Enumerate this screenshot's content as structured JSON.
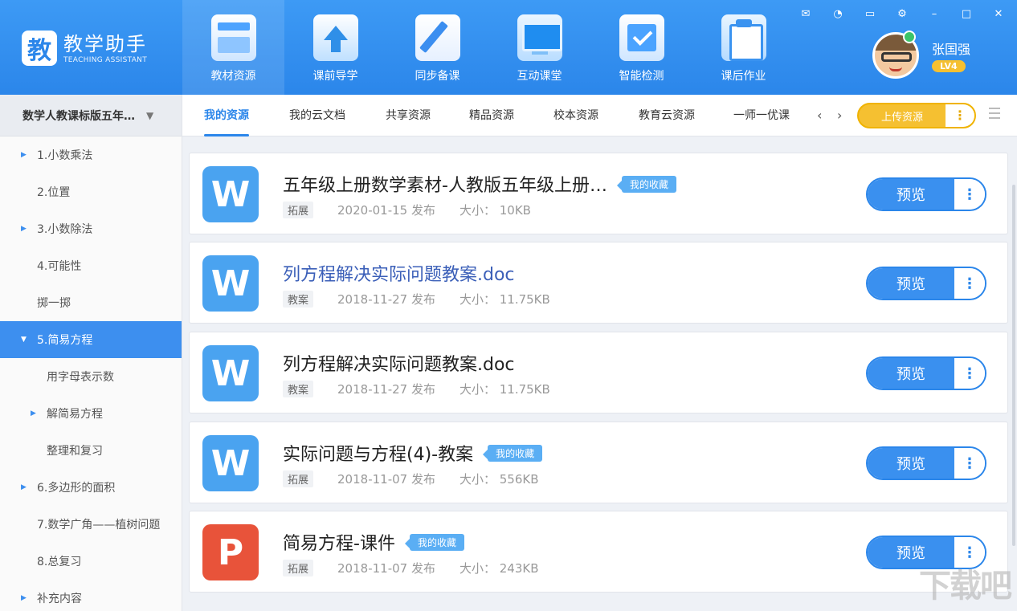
{
  "app": {
    "logo_char": "教",
    "name": "教学助手",
    "name_en": "TEACHING ASSISTANT"
  },
  "modules": [
    {
      "label": "教材资源"
    },
    {
      "label": "课前导学"
    },
    {
      "label": "同步备课"
    },
    {
      "label": "互动课堂"
    },
    {
      "label": "智能检测"
    },
    {
      "label": "课后作业"
    }
  ],
  "window_controls": {
    "message": "✉",
    "support": "◔",
    "chat": "▭",
    "settings": "⚙",
    "minimize": "–",
    "maximize": "□",
    "close": "✕"
  },
  "user": {
    "name": "张国强",
    "level": "LV4"
  },
  "sidebar": {
    "textbook": "数学人教课标版五年…",
    "textbook_arrow": "▼",
    "items": [
      {
        "label": "1.小数乘法",
        "arrow": "▶"
      },
      {
        "label": "2.位置",
        "arrow": ""
      },
      {
        "label": "3.小数除法",
        "arrow": "▶"
      },
      {
        "label": "4.可能性",
        "arrow": ""
      },
      {
        "label": "掷一掷",
        "arrow": ""
      },
      {
        "label": "5.简易方程",
        "arrow": "▼"
      },
      {
        "label": "用字母表示数",
        "arrow": ""
      },
      {
        "label": "解简易方程",
        "arrow": "▶"
      },
      {
        "label": "整理和复习",
        "arrow": ""
      },
      {
        "label": "6.多边形的面积",
        "arrow": "▶"
      },
      {
        "label": "7.数学广角——植树问题",
        "arrow": ""
      },
      {
        "label": "8.总复习",
        "arrow": ""
      },
      {
        "label": "补充内容",
        "arrow": "▶"
      }
    ]
  },
  "tabs": [
    {
      "label": "我的资源"
    },
    {
      "label": "我的云文档"
    },
    {
      "label": "共享资源"
    },
    {
      "label": "精品资源"
    },
    {
      "label": "校本资源"
    },
    {
      "label": "教育云资源"
    },
    {
      "label": "一师一优课"
    }
  ],
  "tab_nav": {
    "prev": "‹",
    "next": "›"
  },
  "upload": {
    "label": "上传资源",
    "more": "⋮"
  },
  "files": [
    {
      "type_letter": "W",
      "title": "五年级上册数学素材-人教版五年级上册…",
      "badge": "我的收藏",
      "tag": "拓展",
      "date": "2020-01-15 发布",
      "size": "大小： 10KB"
    },
    {
      "type_letter": "W",
      "title": "列方程解决实际问题教案.doc",
      "badge": "",
      "tag": "教案",
      "date": "2018-11-27 发布",
      "size": "大小： 11.75KB"
    },
    {
      "type_letter": "W",
      "title": "列方程解决实际问题教案.doc",
      "badge": "",
      "tag": "教案",
      "date": "2018-11-27 发布",
      "size": "大小： 11.75KB"
    },
    {
      "type_letter": "W",
      "title": "实际问题与方程(4)-教案",
      "badge": "我的收藏",
      "tag": "拓展",
      "date": "2018-11-07 发布",
      "size": "大小： 556KB"
    },
    {
      "type_letter": "P",
      "title": "简易方程-课件",
      "badge": "我的收藏",
      "tag": "拓展",
      "date": "2018-11-07 发布",
      "size": "大小： 243KB"
    }
  ],
  "preview": {
    "label": "预览",
    "more": "⋮"
  },
  "watermark": "下载吧"
}
